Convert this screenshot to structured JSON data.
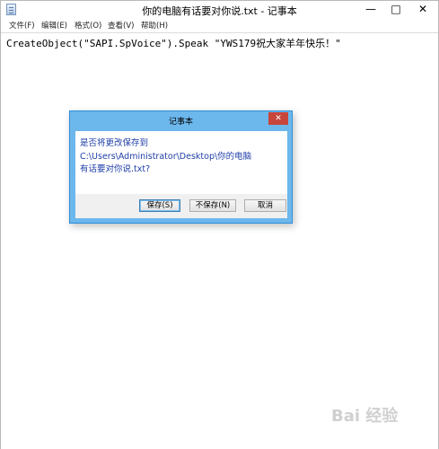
{
  "window": {
    "title": "你的电脑有话要对你说.txt - 记事本",
    "minimize_glyph": "—",
    "maximize_glyph": "□",
    "close_glyph": "✕"
  },
  "menu": [
    "文件(F)",
    "编辑(E)",
    "格式(O)",
    "查看(V)",
    "帮助(H)"
  ],
  "editor": {
    "content": "CreateObject(\"SAPI.SpVoice\").Speak \"YWS179祝大家羊年快乐！\""
  },
  "dialog": {
    "title": "记事本",
    "close_glyph": "✕",
    "message_line1": "是否将更改保存到",
    "message_line2": "C:\\Users\\Administrator\\Desktop\\你的电脑",
    "message_line3": "有话要对你说.txt?",
    "buttons": {
      "save": "保存(S)",
      "dont_save": "不保存(N)",
      "cancel": "取消"
    }
  },
  "watermark": "Bai 经验"
}
